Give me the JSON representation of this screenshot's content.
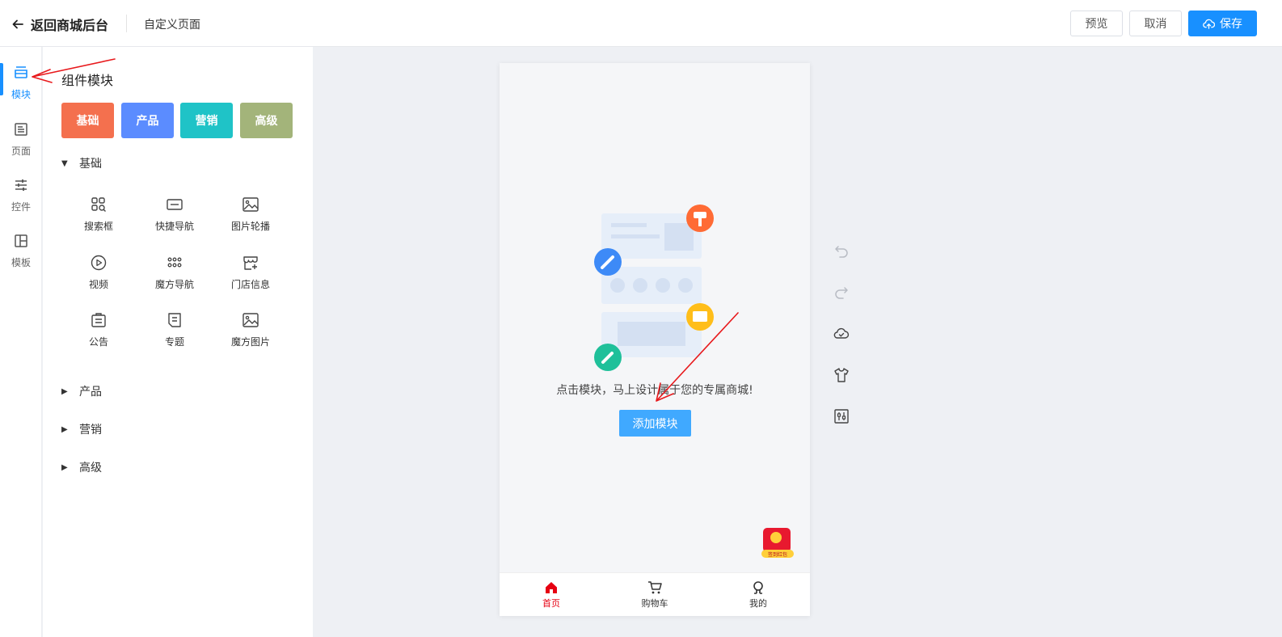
{
  "header": {
    "back_label": "返回商城后台",
    "subtitle": "自定义页面",
    "preview_label": "预览",
    "cancel_label": "取消",
    "save_label": "保存"
  },
  "rail": {
    "items": [
      {
        "label": "模块",
        "icon": "module-icon"
      },
      {
        "label": "页面",
        "icon": "page-icon"
      },
      {
        "label": "控件",
        "icon": "sliders-icon"
      },
      {
        "label": "模板",
        "icon": "template-icon"
      }
    ],
    "active": "模块"
  },
  "panel": {
    "title": "组件模块",
    "categories": [
      {
        "label": "基础",
        "color": "#f4704e"
      },
      {
        "label": "产品",
        "color": "#5b8cff"
      },
      {
        "label": "营销",
        "color": "#1fc3c7"
      },
      {
        "label": "高级",
        "color": "#a3b47a"
      }
    ],
    "sections": [
      {
        "title": "基础",
        "expanded": true,
        "components": [
          {
            "label": "搜索框",
            "icon": "search-box-icon"
          },
          {
            "label": "快捷导航",
            "icon": "quick-nav-icon"
          },
          {
            "label": "图片轮播",
            "icon": "carousel-icon"
          },
          {
            "label": "视频",
            "icon": "video-icon"
          },
          {
            "label": "魔方导航",
            "icon": "cube-nav-icon"
          },
          {
            "label": "门店信息",
            "icon": "store-icon"
          },
          {
            "label": "公告",
            "icon": "notice-icon"
          },
          {
            "label": "专题",
            "icon": "topic-icon"
          },
          {
            "label": "魔方图片",
            "icon": "cube-image-icon"
          }
        ]
      },
      {
        "title": "产品",
        "expanded": false
      },
      {
        "title": "营销",
        "expanded": false
      },
      {
        "title": "高级",
        "expanded": false
      }
    ]
  },
  "phone": {
    "empty_text": "点击模块，马上设计属于您的专属商城!",
    "add_label": "添加模块",
    "redpack_label": "签到红包",
    "tabbar": [
      {
        "label": "首页",
        "icon": "home-icon",
        "active": true
      },
      {
        "label": "购物车",
        "icon": "cart-icon",
        "active": false
      },
      {
        "label": "我的",
        "icon": "user-icon",
        "active": false
      }
    ]
  },
  "tools": [
    "undo-icon",
    "redo-icon",
    "cloud-check-icon",
    "tshirt-icon",
    "adjust-icon"
  ],
  "colors": {
    "primary": "#1890ff",
    "add_button": "#40a9ff",
    "tab_active": "#e60012",
    "annotation": "#e8191c"
  }
}
